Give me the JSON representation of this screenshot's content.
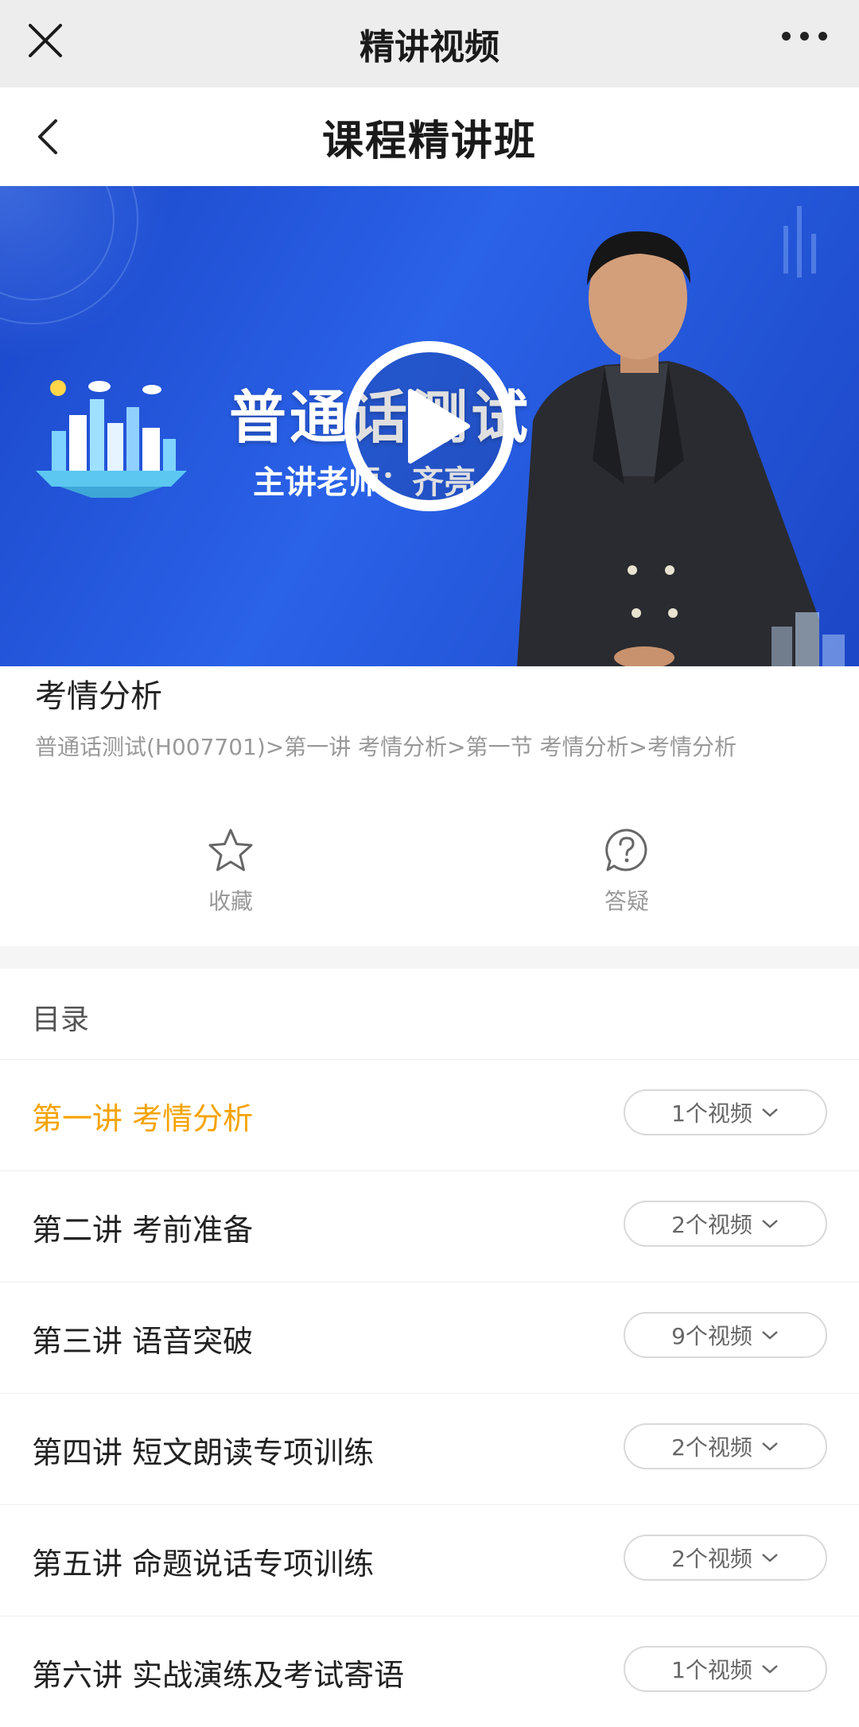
{
  "window": {
    "title": "精讲视频"
  },
  "nav": {
    "title": "课程精讲班"
  },
  "video": {
    "headline": "普通话测试",
    "teacher_line": "主讲老师：齐亮"
  },
  "lesson": {
    "title": "考情分析",
    "breadcrumb": "普通话测试(H007701)>第一讲 考情分析>第一节 考情分析>考情分析"
  },
  "actions": {
    "favorite": "收藏",
    "qa": "答疑"
  },
  "catalog": {
    "title": "目录",
    "accent_color": "#f5a300",
    "chapters": [
      {
        "name": "第一讲 考情分析",
        "count": "1个视频",
        "active": true
      },
      {
        "name": "第二讲 考前准备",
        "count": "2个视频",
        "active": false
      },
      {
        "name": "第三讲 语音突破",
        "count": "9个视频",
        "active": false
      },
      {
        "name": "第四讲 短文朗读专项训练",
        "count": "2个视频",
        "active": false
      },
      {
        "name": "第五讲 命题说话专项训练",
        "count": "2个视频",
        "active": false
      },
      {
        "name": "第六讲 实战演练及考试寄语",
        "count": "1个视频",
        "active": false
      }
    ]
  }
}
